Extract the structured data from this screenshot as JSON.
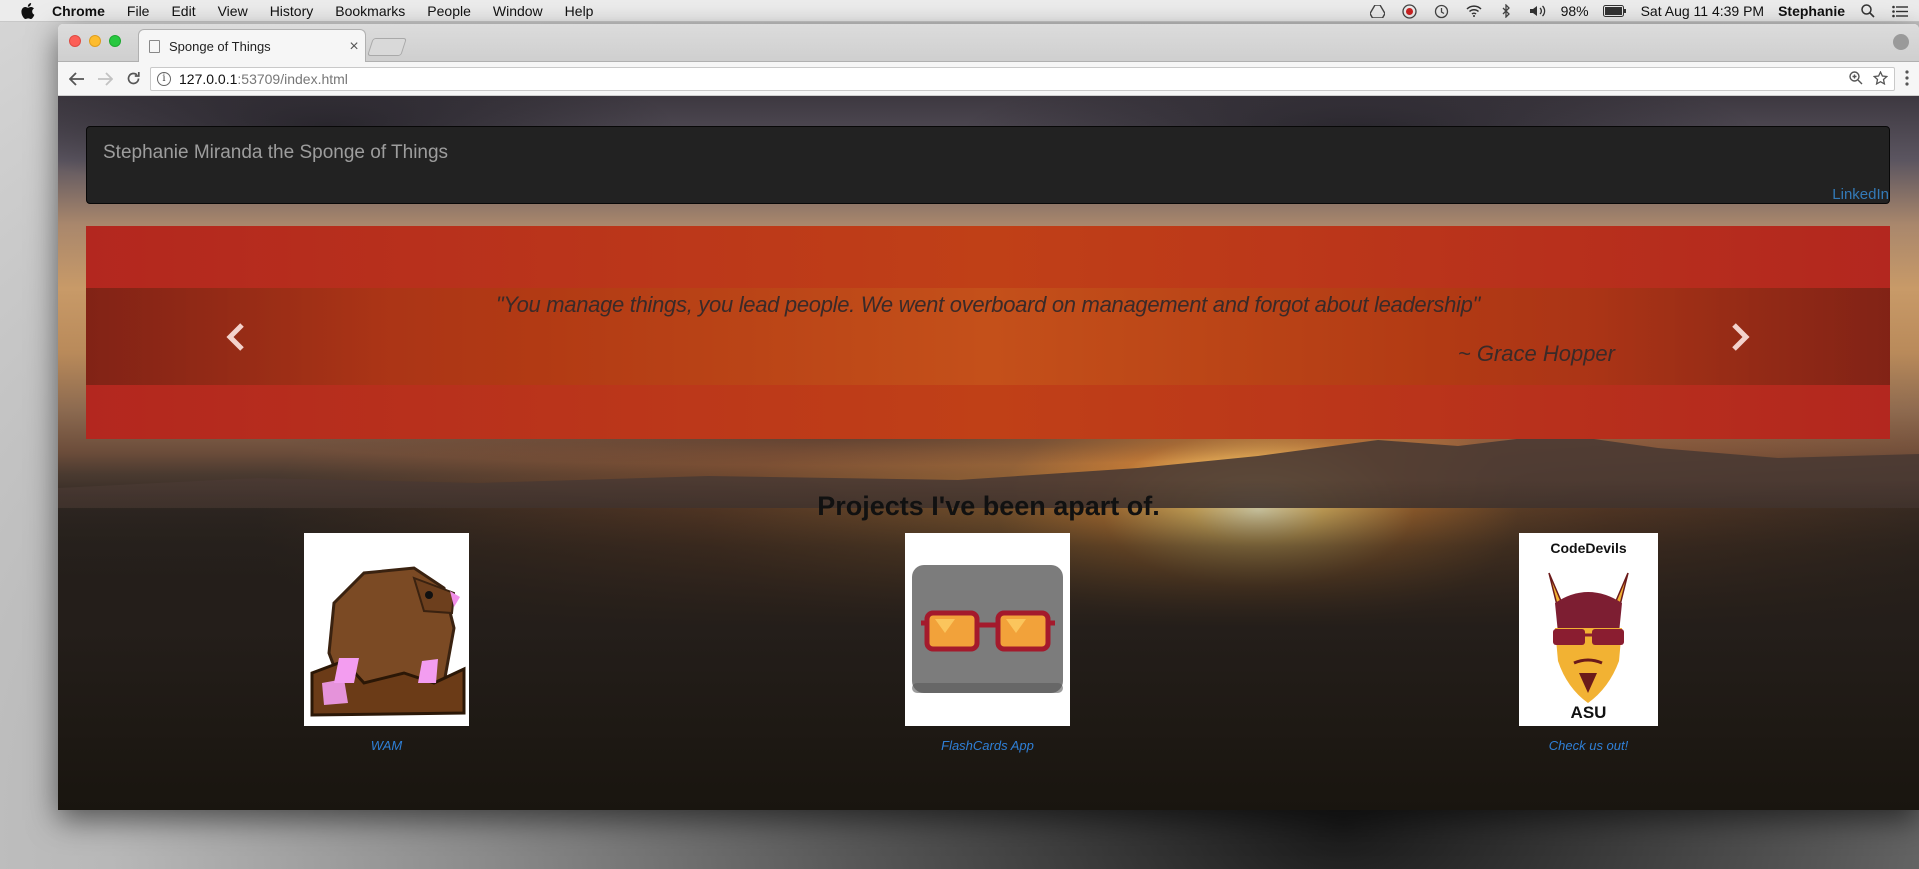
{
  "menubar": {
    "app_name": "Chrome",
    "items": [
      "File",
      "Edit",
      "View",
      "History",
      "Bookmarks",
      "People",
      "Window",
      "Help"
    ],
    "battery": "98%",
    "datetime": "Sat Aug 11  4:39 PM",
    "user": "Stephanie"
  },
  "browser": {
    "tab_title": "Sponge of Things",
    "tab_close": "×",
    "url_host": "127.0.0.1",
    "url_rest": ":53709/index.html"
  },
  "page": {
    "brand": "Stephanie Miranda the Sponge of Things",
    "nav_link": "LinkedIn",
    "carousel": {
      "quote": "\"You manage things, you lead people. We went overboard on management and forgot about leadership\"",
      "author": "~ Grace Hopper",
      "prev": "‹",
      "next": "›"
    },
    "projects_heading": "Projects I've been apart of.",
    "projects": [
      {
        "caption": "WAM"
      },
      {
        "caption": "FlashCards App"
      },
      {
        "caption": "Check us out!",
        "logo_title": "CodeDevils",
        "logo_sub": "ASU"
      }
    ],
    "colors": {
      "navbar_bg": "#222222",
      "brand_text": "#9d9d9d",
      "link": "#337ab7",
      "carousel_bg": "#bf3a1c"
    }
  }
}
